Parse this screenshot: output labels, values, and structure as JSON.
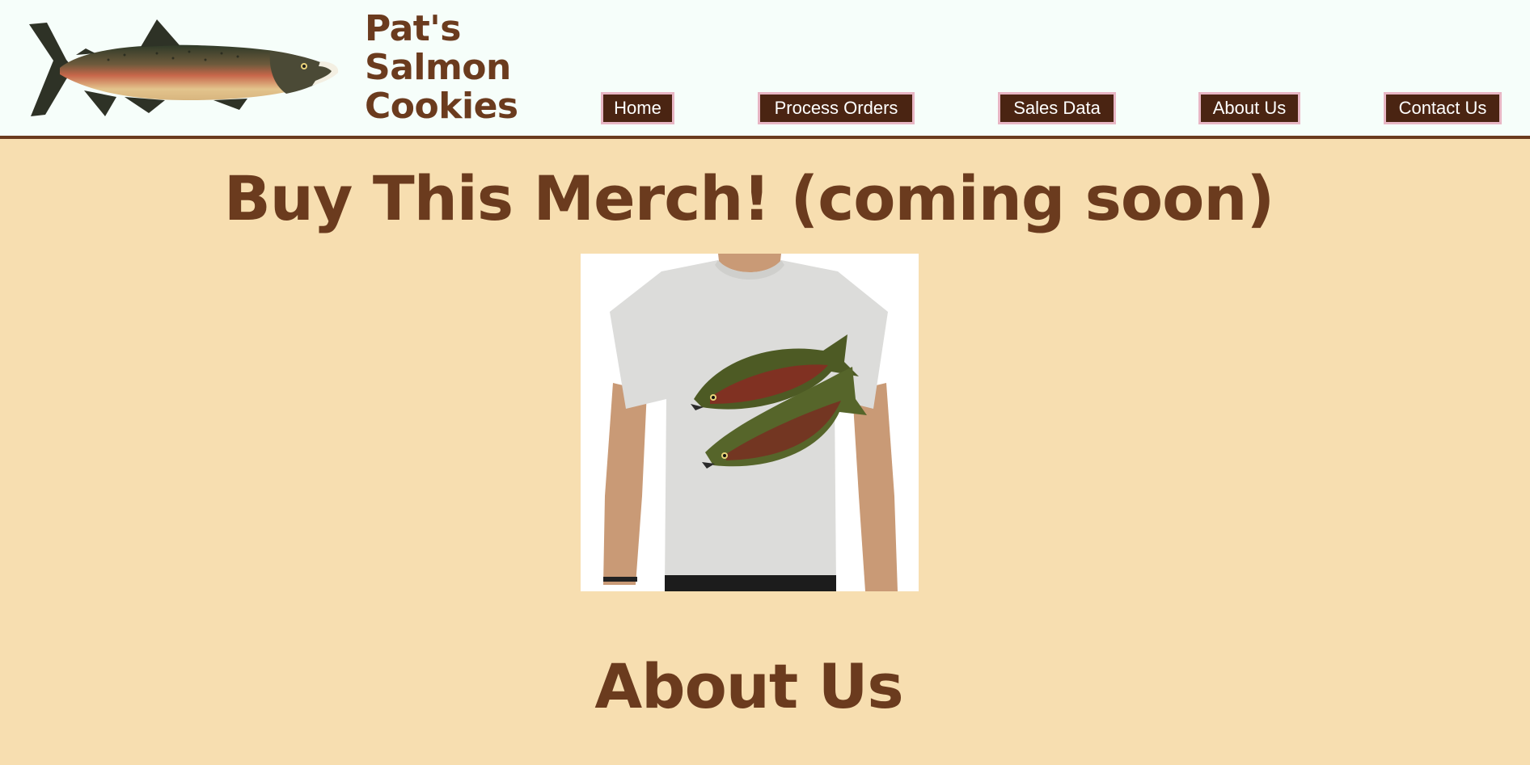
{
  "header": {
    "brand_lines": [
      "Pat's",
      "Salmon",
      "Cookies"
    ],
    "logo_icon": "salmon-fish-icon"
  },
  "nav": {
    "home": "Home",
    "process_orders": "Process Orders",
    "sales_data": "Sales Data",
    "about_us": "About Us",
    "contact_us": "Contact Us"
  },
  "main": {
    "merch_heading": "Buy This Merch! (coming soon)",
    "merch_image": "salmon-tshirt-image",
    "about_heading": "About Us"
  },
  "colors": {
    "page_background": "#f7deb0",
    "header_background": "#f6fefa",
    "brand_brown": "#6b3b1e",
    "nav_button_background": "#4a2412",
    "nav_button_border": "#e8b6c4"
  }
}
